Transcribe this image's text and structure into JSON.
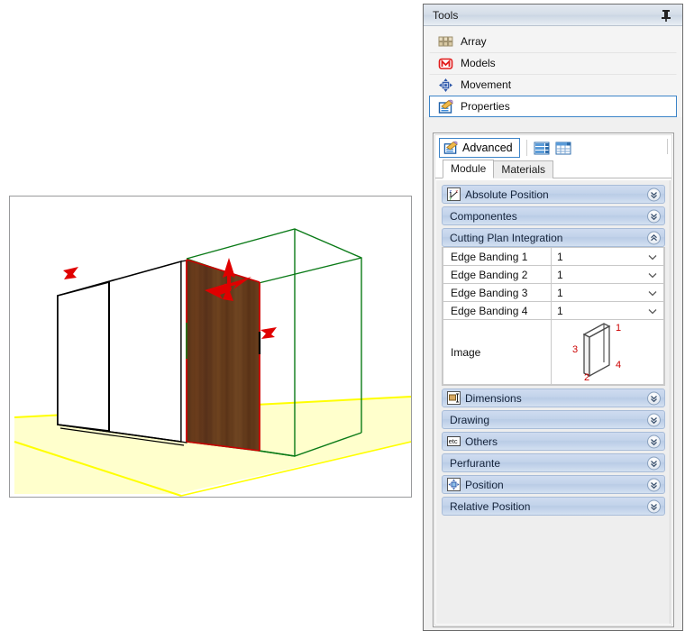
{
  "panel": {
    "title": "Tools",
    "pin_icon": "pin-icon"
  },
  "tool_list": [
    {
      "label": "Array",
      "icon": "array-grid-icon",
      "selected": false
    },
    {
      "label": "Models",
      "icon": "models-m-icon",
      "selected": false
    },
    {
      "label": "Movement",
      "icon": "movement-arrows-icon",
      "selected": false
    },
    {
      "label": "Properties",
      "icon": "properties-doc-icon",
      "selected": true
    }
  ],
  "advanced": {
    "tab_label": "Advanced",
    "tab_icon": "properties-doc-icon",
    "view_buttons": [
      {
        "name": "list-view-icon"
      },
      {
        "name": "table-view-icon"
      }
    ]
  },
  "tabs": [
    {
      "label": "Module",
      "active": true
    },
    {
      "label": "Materials",
      "active": false
    }
  ],
  "sections": [
    {
      "label": "Absolute Position",
      "icon": "axis-position-icon",
      "expanded": false
    },
    {
      "label": "Componentes",
      "icon": null,
      "expanded": false
    },
    {
      "label": "Cutting Plan Integration",
      "icon": null,
      "expanded": true
    },
    {
      "label": "Dimensions",
      "icon": "dimensions-icon",
      "expanded": false
    },
    {
      "label": "Drawing",
      "icon": null,
      "expanded": false
    },
    {
      "label": "Others",
      "icon": "etc-icon",
      "expanded": false
    },
    {
      "label": "Perfurante",
      "icon": null,
      "expanded": false
    },
    {
      "label": "Position",
      "icon": "position-icon",
      "expanded": false
    },
    {
      "label": "Relative Position",
      "icon": null,
      "expanded": false
    }
  ],
  "cutting_plan": {
    "rows": [
      {
        "label": "Edge Banding 1",
        "value": "1"
      },
      {
        "label": "Edge Banding 2",
        "value": "1"
      },
      {
        "label": "Edge Banding 3",
        "value": "1"
      },
      {
        "label": "Edge Banding 4",
        "value": "1"
      }
    ],
    "image_label": "Image",
    "image_edge_numbers": [
      "1",
      "2",
      "3",
      "4"
    ]
  },
  "viewport": {
    "name": "3d-viewport",
    "colors": {
      "selection_bbox": "#0a7a17",
      "selected_edge": "#ff0000",
      "floor": "#ffffcc",
      "floor_edge": "#ffff00",
      "panel_wood_dark": "#4a2c15",
      "panel_wood_light": "#7a4a22",
      "wireframe": "#000000",
      "gizmo": "#e00000"
    }
  }
}
